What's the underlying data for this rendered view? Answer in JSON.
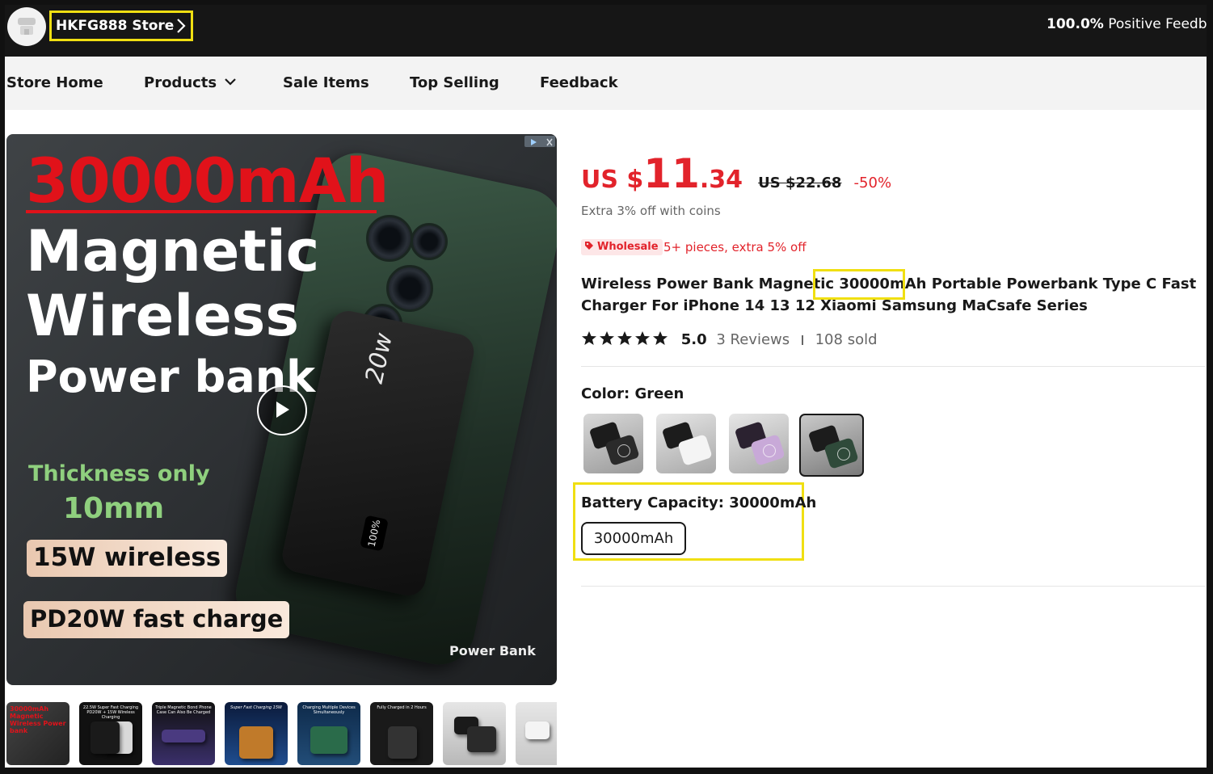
{
  "header": {
    "store_name": "HKFG888 Store",
    "feedback_value": "100.0%",
    "feedback_label": "Positive Feedba"
  },
  "nav": {
    "items": [
      "Store Home",
      "Products",
      "Sale Items",
      "Top Selling",
      "Feedback"
    ]
  },
  "gallery": {
    "main_image": {
      "headline": "30000mAh",
      "line1": "Magnetic",
      "line2": "Wireless",
      "line3": "Power bank",
      "thickness_label": "Thickness only",
      "thickness_value": "10mm",
      "pill1": "15W wireless",
      "pill2": "PD20W fast charge",
      "brand_caption": "Power Bank",
      "device_text": "20w",
      "led_text": "100%"
    },
    "thumbnails": [
      {
        "caption": "30000mAh Magnetic Wireless Power bank"
      },
      {
        "caption": "22.5W Super Fast Charging PD20W + 15W Wireless Charging"
      },
      {
        "caption": "Triple Magnetic Bond Phone Case Can Also Be Charged"
      },
      {
        "caption": "Super Fast Charging 15W"
      },
      {
        "caption": "Charging Multiple Devices Simultaneously"
      },
      {
        "caption": "Fully Charged in 2 Hours"
      },
      {
        "caption": ""
      },
      {
        "caption": ""
      }
    ]
  },
  "product": {
    "price_currency": "US $",
    "price_int": "11",
    "price_dec": ".34",
    "price_old": "US $22.68",
    "discount": "-50%",
    "coins_note": "Extra 3% off with coins",
    "wholesale_badge": "Wholesale",
    "wholesale_text": "5+ pieces, extra 5% off",
    "title_part1": "Wireless Power Bank Magnetic ",
    "title_highlight": "30000mAh",
    "title_part2": " Portable Powerbank Type C Fast Charger For iPhone 14 13 12 Xiaomi Samsung MaCsafe Series",
    "rating": "5.0",
    "reviews": "3 Reviews",
    "sold": "108 sold",
    "color_label": "Color: Green",
    "color_options": [
      {
        "name": "Black",
        "selected": false
      },
      {
        "name": "White",
        "selected": false
      },
      {
        "name": "Purple",
        "selected": false
      },
      {
        "name": "Green",
        "selected": true
      }
    ],
    "capacity_label": "Battery Capacity: 30000mAh",
    "capacity_option": "30000mAh"
  },
  "colors": {
    "accent": "#e2232b",
    "highlight": "#f0df12",
    "header_bg": "#161616"
  }
}
